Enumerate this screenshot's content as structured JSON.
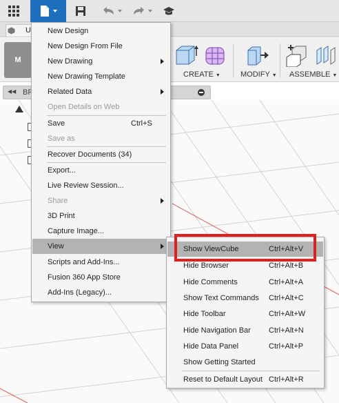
{
  "colors": {
    "accent": "#1f6fbf",
    "highlight": "#e02020",
    "canvas_red_axis": "#e06060"
  },
  "app_bar": {
    "icons": [
      "apps-grid-icon",
      "file-icon",
      "save-icon",
      "undo-icon",
      "redo-icon",
      "learn-icon"
    ]
  },
  "document_tab": {
    "label": "U"
  },
  "ribbon": {
    "mode_label": "M",
    "groups": [
      {
        "label": "CREATE"
      },
      {
        "label": "MODIFY"
      },
      {
        "label": "ASSEMBLE"
      }
    ]
  },
  "browser": {
    "label": "BR"
  },
  "file_menu": {
    "items": [
      {
        "label": "New Design",
        "shortcut": "",
        "submenu": false,
        "disabled": false
      },
      {
        "label": "New Design From File",
        "shortcut": "",
        "submenu": false,
        "disabled": false
      },
      {
        "label": "New Drawing",
        "shortcut": "",
        "submenu": true,
        "disabled": false
      },
      {
        "label": "New Drawing Template",
        "shortcut": "",
        "submenu": false,
        "disabled": false
      },
      {
        "label": "Related Data",
        "shortcut": "",
        "submenu": true,
        "disabled": false
      },
      {
        "label": "Open Details on Web",
        "shortcut": "",
        "submenu": false,
        "disabled": true
      },
      {
        "label": "Save",
        "shortcut": "Ctrl+S",
        "submenu": false,
        "disabled": false
      },
      {
        "label": "Save as",
        "shortcut": "",
        "submenu": false,
        "disabled": true
      },
      {
        "label": "Recover Documents (34)",
        "shortcut": "",
        "submenu": false,
        "disabled": false
      },
      {
        "label": "Export...",
        "shortcut": "",
        "submenu": false,
        "disabled": false
      },
      {
        "label": "Live Review Session...",
        "shortcut": "",
        "submenu": false,
        "disabled": false
      },
      {
        "label": "Share",
        "shortcut": "",
        "submenu": true,
        "disabled": true
      },
      {
        "label": "3D Print",
        "shortcut": "",
        "submenu": false,
        "disabled": false
      },
      {
        "label": "Capture Image...",
        "shortcut": "",
        "submenu": false,
        "disabled": false
      },
      {
        "label": "View",
        "shortcut": "",
        "submenu": true,
        "disabled": false,
        "highlighted": true
      },
      {
        "label": "Scripts and Add-Ins...",
        "shortcut": "",
        "submenu": false,
        "disabled": false
      },
      {
        "label": "Fusion 360 App Store",
        "shortcut": "",
        "submenu": false,
        "disabled": false
      },
      {
        "label": "Add-Ins (Legacy)...",
        "shortcut": "",
        "submenu": false,
        "disabled": false
      }
    ]
  },
  "view_menu": {
    "items": [
      {
        "label": "Show ViewCube",
        "shortcut": "Ctrl+Alt+V",
        "highlighted": true
      },
      {
        "label": "Hide Browser",
        "shortcut": "Ctrl+Alt+B"
      },
      {
        "label": "Hide Comments",
        "shortcut": "Ctrl+Alt+A"
      },
      {
        "label": "Show Text Commands",
        "shortcut": "Ctrl+Alt+C"
      },
      {
        "label": "Hide Toolbar",
        "shortcut": "Ctrl+Alt+W"
      },
      {
        "label": "Hide Navigation Bar",
        "shortcut": "Ctrl+Alt+N"
      },
      {
        "label": "Hide Data Panel",
        "shortcut": "Ctrl+Alt+P"
      },
      {
        "label": "Show Getting Started",
        "shortcut": ""
      },
      {
        "label": "Reset to Default Layout",
        "shortcut": "Ctrl+Alt+R"
      }
    ]
  }
}
